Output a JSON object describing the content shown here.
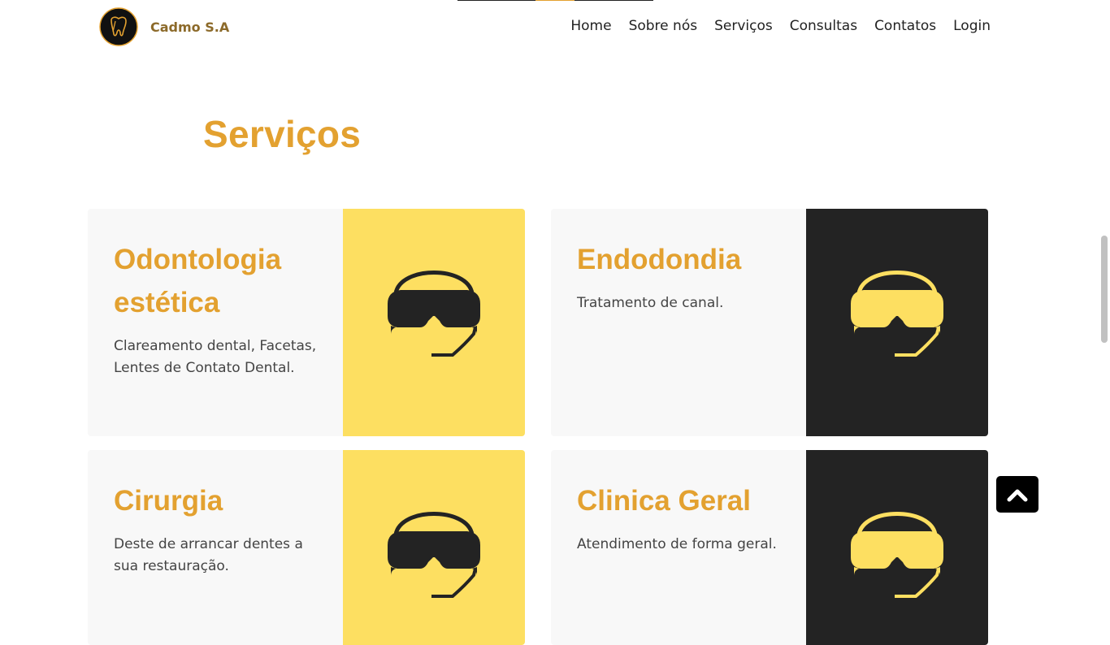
{
  "brand": {
    "name": "Cadmo S.A",
    "logo_icon": "tooth-logo-icon"
  },
  "nav": {
    "items": [
      {
        "label": "Home"
      },
      {
        "label": "Sobre nós"
      },
      {
        "label": "Serviços"
      },
      {
        "label": "Consultas"
      },
      {
        "label": "Contatos"
      },
      {
        "label": "Login"
      }
    ]
  },
  "services": {
    "title": "Serviços",
    "cards": [
      {
        "title": "Odontologia estética",
        "description": "Clareamento dental, Facetas, Lentes de Contato Dental.",
        "icon": "vr-headset-icon",
        "media_color": "#fddf61",
        "icon_color": "#232323"
      },
      {
        "title": "Endodondia",
        "description": "Tratamento de canal.",
        "icon": "vr-headset-icon",
        "media_color": "#232323",
        "icon_color": "#fddf61"
      },
      {
        "title": "Cirurgia",
        "description": "Deste de arrancar dentes a sua restauração.",
        "icon": "vr-headset-icon",
        "media_color": "#fddf61",
        "icon_color": "#232323"
      },
      {
        "title": "Clinica Geral",
        "description": "Atendimento de forma geral.",
        "icon": "vr-headset-icon",
        "media_color": "#232323",
        "icon_color": "#fddf61"
      }
    ]
  },
  "back_to_top": {
    "icon": "chevron-up-icon"
  },
  "colors": {
    "accent": "#e3a130",
    "yellow": "#fddf61",
    "dark": "#232323",
    "card_bg": "#f8f8f8"
  }
}
